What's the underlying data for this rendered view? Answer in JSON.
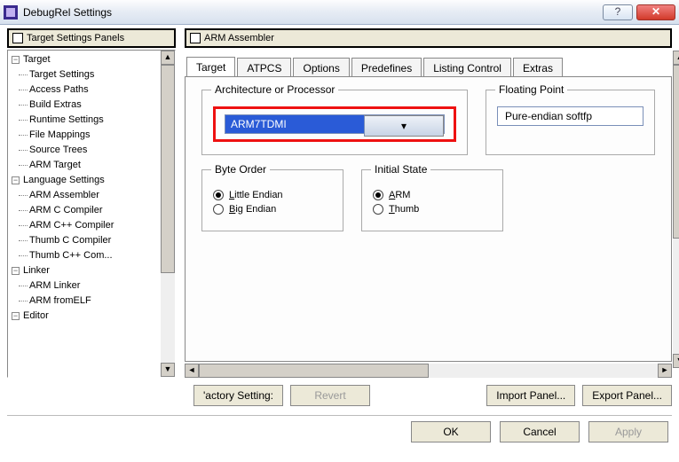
{
  "window": {
    "title": "DebugRel Settings"
  },
  "panels": {
    "left_title": "Target Settings Panels",
    "right_title": "ARM Assembler"
  },
  "tree": {
    "nodes": [
      {
        "label": "Target",
        "expanded": true,
        "children": [
          "Target Settings",
          "Access Paths",
          "Build Extras",
          "Runtime Settings",
          "File Mappings",
          "Source Trees",
          "ARM Target"
        ]
      },
      {
        "label": "Language Settings",
        "expanded": true,
        "children": [
          "ARM Assembler",
          "ARM C Compiler",
          "ARM C++ Compiler",
          "Thumb C Compiler",
          "Thumb C++ Com..."
        ]
      },
      {
        "label": "Linker",
        "expanded": true,
        "children": [
          "ARM Linker",
          "ARM fromELF"
        ]
      },
      {
        "label": "Editor",
        "expanded": true,
        "children": []
      }
    ]
  },
  "tabs": [
    "Target",
    "ATPCS",
    "Options",
    "Predefines",
    "Listing Control",
    "Extras"
  ],
  "active_tab": 0,
  "arch": {
    "legend": "Architecture or Processor",
    "value": "ARM7TDMI"
  },
  "fp": {
    "legend": "Floating Point",
    "value": "Pure-endian softfp"
  },
  "byteorder": {
    "legend": "Byte Order",
    "options": [
      "Little Endian",
      "Big Endian"
    ],
    "selected": 0,
    "accel": [
      "L",
      "B"
    ]
  },
  "initstate": {
    "legend": "Initial State",
    "options": [
      "ARM",
      "Thumb"
    ],
    "selected": 0,
    "accel": [
      "A",
      "T"
    ]
  },
  "buttons": {
    "factory": "'actory Setting:",
    "revert": "Revert",
    "import": "Import Panel...",
    "export": "Export Panel...",
    "ok": "OK",
    "cancel": "Cancel",
    "apply": "Apply"
  }
}
